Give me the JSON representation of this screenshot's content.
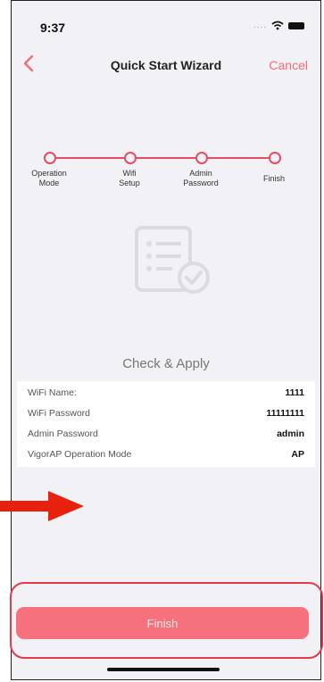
{
  "status": {
    "time": "9:37"
  },
  "nav": {
    "title": "Quick Start Wizard",
    "cancel": "Cancel"
  },
  "steps": [
    {
      "line1": "Operation",
      "line2": "Mode"
    },
    {
      "line1": "Wifi",
      "line2": "Setup"
    },
    {
      "line1": "Admin",
      "line2": "Password"
    },
    {
      "line1": "Finish",
      "line2": ""
    }
  ],
  "apply_title": "Check & Apply",
  "summary": [
    {
      "key": "WiFi Name:",
      "value": "1111"
    },
    {
      "key": "WiFi Password",
      "value": "11111111"
    },
    {
      "key": "Admin Password",
      "value": "admin"
    },
    {
      "key": "VigorAP Operation Mode",
      "value": "AP"
    }
  ],
  "finish_label": "Finish",
  "colors": {
    "accent": "#e24f64",
    "cancel": "#f06b7b",
    "button": "#f4717d",
    "highlight": "#e53a4a"
  }
}
